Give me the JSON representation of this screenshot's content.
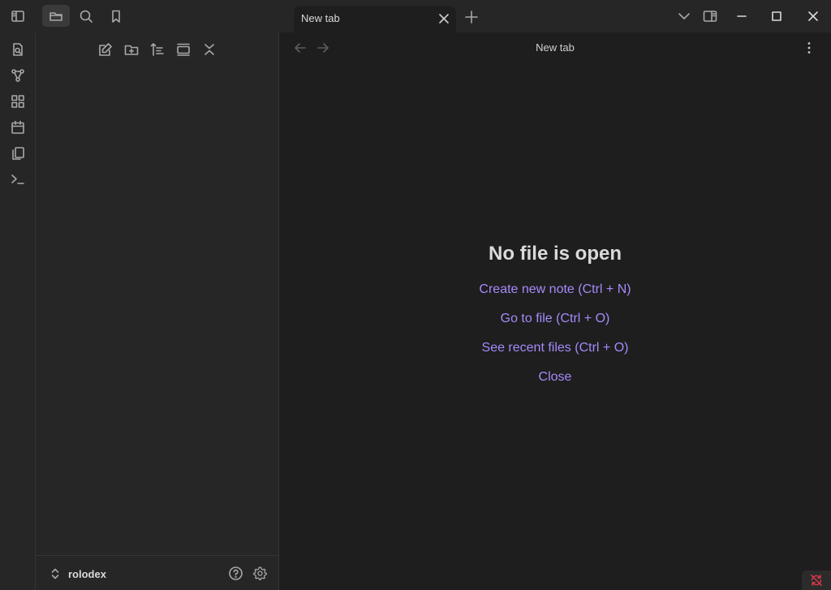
{
  "titlebar": {
    "icons": {
      "sidebar_toggle": "sidebar-left-icon",
      "files": "folder-icon",
      "search": "search-icon",
      "bookmarks": "bookmark-icon"
    },
    "tab": {
      "title": "New tab"
    },
    "window_controls": [
      "chevron-down-icon",
      "sidebar-right-icon",
      "minimize-icon",
      "maximize-icon",
      "close-icon"
    ]
  },
  "ribbon": {
    "items": [
      "open-quick-switcher-icon",
      "graph-view-icon",
      "canvas-icon",
      "daily-notes-icon",
      "templates-icon",
      "command-palette-icon"
    ]
  },
  "sidebar": {
    "nav_actions": [
      "new-note-icon",
      "new-folder-icon",
      "sort-icon",
      "auto-reveal-icon",
      "collapse-all-icon"
    ],
    "vault": {
      "name": "rolodex"
    }
  },
  "main": {
    "header_title": "New tab",
    "empty_state": {
      "title": "No file is open",
      "actions": [
        "Create new note (Ctrl + N)",
        "Go to file (Ctrl + O)",
        "See recent files (Ctrl + O)",
        "Close"
      ]
    }
  },
  "colors": {
    "accent": "#a68af9",
    "background": "#1e1e1e",
    "sidebar": "#262626",
    "sync_error": "#e03a4a"
  }
}
